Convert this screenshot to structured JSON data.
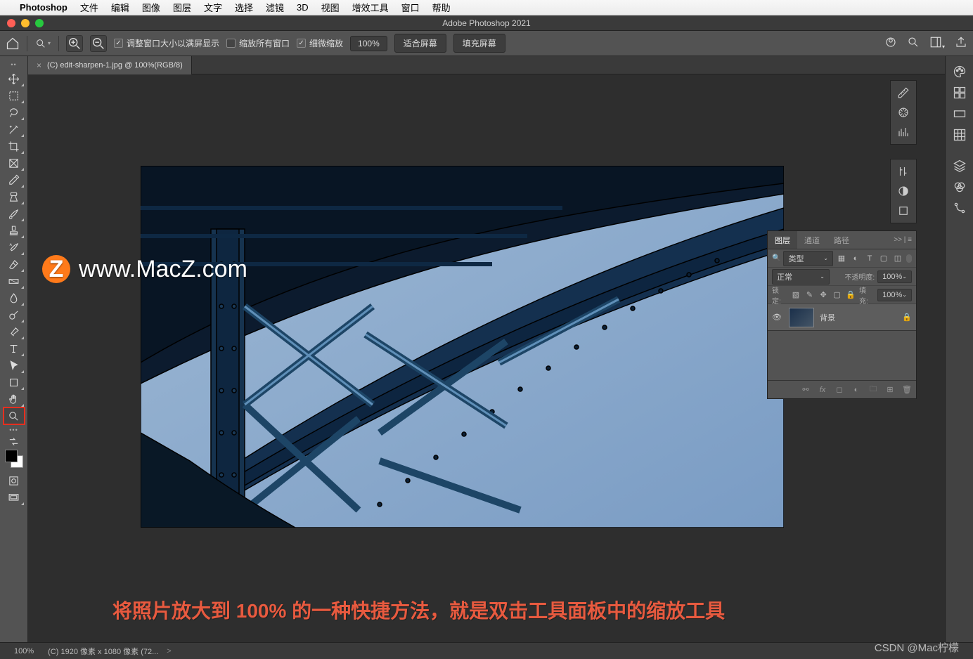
{
  "macmenu": {
    "app": "Photoshop",
    "items": [
      "文件",
      "编辑",
      "图像",
      "图层",
      "文字",
      "选择",
      "滤镜",
      "3D",
      "视图",
      "增效工具",
      "窗口",
      "帮助"
    ]
  },
  "titlebar": {
    "title": "Adobe Photoshop 2021"
  },
  "options": {
    "resize_window": "调整窗口大小以满屏显示",
    "zoom_all": "缩放所有窗口",
    "scrubby": "细微缩放",
    "percent": "100%",
    "fit": "适合屏幕",
    "fill": "填充屏幕"
  },
  "doc": {
    "tab": "(C) edit-sharpen-1.jpg @ 100%(RGB/8)"
  },
  "layers_panel": {
    "tabs": [
      "图层",
      "通道",
      "路径"
    ],
    "collapse": ">> | ≡",
    "kind_label": "类型",
    "blend": "正常",
    "opacity_label": "不透明度:",
    "opacity_val": "100%",
    "lock_label": "锁定:",
    "fill_label": "填充:",
    "fill_val": "100%",
    "layer_name": "背景"
  },
  "status": {
    "zoom": "100%",
    "dims": "(C) 1920 像素 x 1080 像素 (72...",
    "caret": ">"
  },
  "watermark": {
    "badge": "Z",
    "text": "www.MacZ.com"
  },
  "caption": "将照片放大到 100% 的一种快捷方法，就是双击工具面板中的缩放工具",
  "csdn": "CSDN @Mac柠檬",
  "tools": [
    "move",
    "marquee",
    "lasso",
    "wand",
    "crop",
    "frame",
    "eyedrop",
    "heal",
    "brush",
    "stamp",
    "history",
    "eraser",
    "gradient",
    "blur",
    "dodge",
    "pen",
    "type",
    "path",
    "shape",
    "hand",
    "zoom"
  ],
  "right_icons_a": [
    "ruler-icon",
    "wheel-icon",
    "histogram-icon"
  ],
  "right_icons_b": [
    "adjust-icon",
    "contrast-icon",
    "rect-icon"
  ],
  "right_icons_c": [
    "layers-icon",
    "channels-icon",
    "paths-icon"
  ],
  "strip_icons": [
    "color-icon",
    "swatches-icon",
    "gradient-icon",
    "patterns-icon"
  ]
}
